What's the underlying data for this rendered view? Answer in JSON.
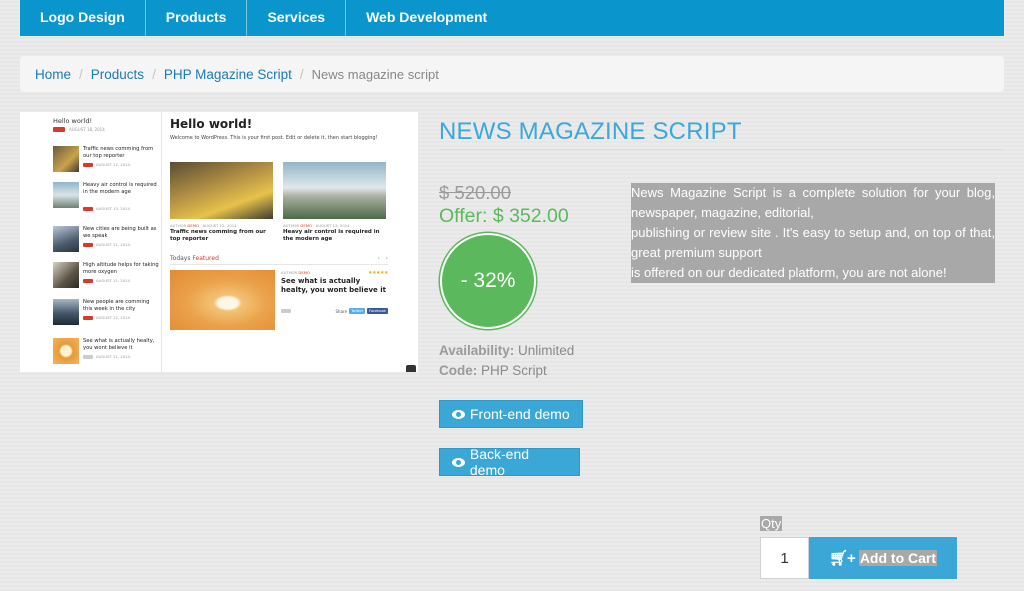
{
  "nav": {
    "items": [
      "Logo Design",
      "Products",
      "Services",
      "Web Development"
    ],
    "bg_color": "#0a96cc"
  },
  "breadcrumb": {
    "links": [
      "Home",
      "Products",
      "PHP Magazine Script"
    ],
    "current": "News magazine script"
  },
  "preview": {
    "sidebar": {
      "title": "Hello world!",
      "date": "AUGUST 18, 2014",
      "items": [
        {
          "title": "Traffic news comming from our top reporter",
          "date": "AUGUST 12, 2014"
        },
        {
          "title": "Heavy air control is required in the modern age",
          "date": "AUGUST 13, 2014"
        },
        {
          "title": "New cities are being built as we speak",
          "date": "AUGUST 11, 2014"
        },
        {
          "title": "High altitude helps for taking more oxygen",
          "date": "AUGUST 11, 2014"
        },
        {
          "title": "New people are comming this week in the city",
          "date": "AUGUST 12, 2014"
        },
        {
          "title": "See what is actually healty, you wont believe it",
          "date": "AUGUST 11, 2014"
        }
      ]
    },
    "main": {
      "title": "Hello world!",
      "intro": "Welcome to WordPress. This is your first post. Edit or delete it, then start blogging!",
      "cards": [
        {
          "author_label": "AUTHOR",
          "author": "DEMO",
          "date": "AUGUST 12, 2014",
          "title": "Traffic news comming from our top reporter"
        },
        {
          "author_label": "AUTHOR",
          "author": "DEMO",
          "date": "AUGUST 13, 2014",
          "title": "Heavy air control is required in the modern age"
        }
      ],
      "featured_prefix": "Todays",
      "featured_highlight": "Featured",
      "featured": {
        "author_label": "AUTHOR",
        "author": "DEMO",
        "title": "See what is actually healty, you wont believe it",
        "share_label": "Share",
        "twitter": "Twitter",
        "facebook": "Facebook",
        "rating": 5
      }
    }
  },
  "product": {
    "title": "NEWS MAGAZINE SCRIPT",
    "old_price": "$ 520.00",
    "offer_price": "Offer: $ 352.00",
    "discount": "- 32%",
    "availability_label": "Availability:",
    "availability_value": "Unlimited",
    "code_label": "Code:",
    "code_value": "PHP Script",
    "frontend_demo": "Front-end demo",
    "backend_demo": "Back-end demo",
    "description_lines": [
      "News Magazine Script is a complete solution for your blog, newspaper, magazine, editorial,",
      "publishing or review site . It's easy to setup and, on top of that, great premium support",
      "is offered on our dedicated platform, you are not alone!"
    ],
    "accent_color": "#3ba7db",
    "offer_color": "#5cb85c"
  },
  "cart": {
    "qty_label": "Qty",
    "qty_value": "1",
    "add_to_cart": "Add to Cart"
  }
}
